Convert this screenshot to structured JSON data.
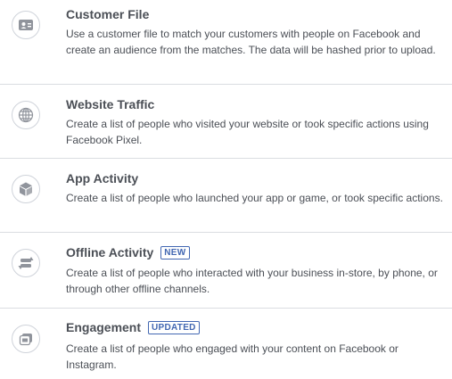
{
  "options": [
    {
      "title": "Customer File",
      "badge": "",
      "description": "Use a customer file to match your customers with people on Facebook and create an audience from the matches. The data will be hashed prior to upload.",
      "icon": "customer-file-icon"
    },
    {
      "title": "Website Traffic",
      "badge": "",
      "description": "Create a list of people who visited your website or took specific actions using Facebook Pixel.",
      "icon": "globe-icon"
    },
    {
      "title": "App Activity",
      "badge": "",
      "description": "Create a list of people who launched your app or game, or took specific actions.",
      "icon": "cube-icon"
    },
    {
      "title": "Offline Activity",
      "badge": "NEW",
      "description": "Create a list of people who interacted with your business in-store, by phone, or through other offline channels.",
      "icon": "offline-sync-icon"
    },
    {
      "title": "Engagement",
      "badge": "UPDATED",
      "description": "Create a list of people who engaged with your content on Facebook or Instagram.",
      "icon": "engagement-icon"
    }
  ],
  "colors": {
    "title": "#4b4f56",
    "text": "#4b4f56",
    "badge": "#4267b2",
    "divider": "#dadde1",
    "icon": "#90949c"
  }
}
